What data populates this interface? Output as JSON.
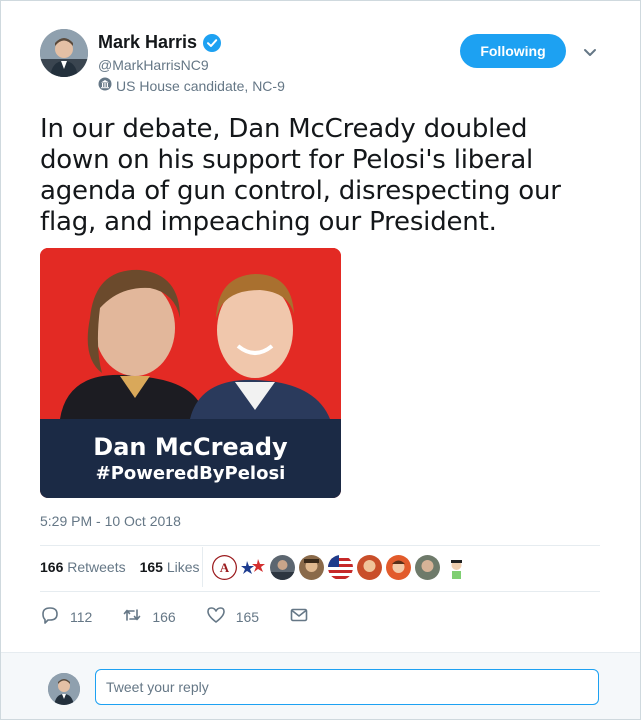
{
  "author": {
    "name": "Mark Harris",
    "handle": "@MarkHarrisNC9",
    "label": "US House candidate, NC-9",
    "verified": true
  },
  "follow_button": {
    "label": "Following"
  },
  "tweet": {
    "text": "In our debate, Dan McCready doubled down on his support for Pelosi's liberal agenda of gun control, disrespecting our flag, and impeaching our President.",
    "timestamp": "5:29 PM - 10 Oct 2018"
  },
  "media": {
    "caption_line1": "Dan McCready",
    "caption_line2": "#PoweredByPelosi"
  },
  "stats": {
    "retweets_count": "166",
    "retweets_label": "Retweets",
    "likes_count": "165",
    "likes_label": "Likes"
  },
  "actions": {
    "reply_count": "112",
    "retweet_count": "166",
    "like_count": "165"
  },
  "reply": {
    "placeholder": "Tweet your reply"
  },
  "colors": {
    "accent": "#1da1f2",
    "media_red": "#e32a24",
    "media_navy": "#1b2a45",
    "muted": "#657786"
  }
}
